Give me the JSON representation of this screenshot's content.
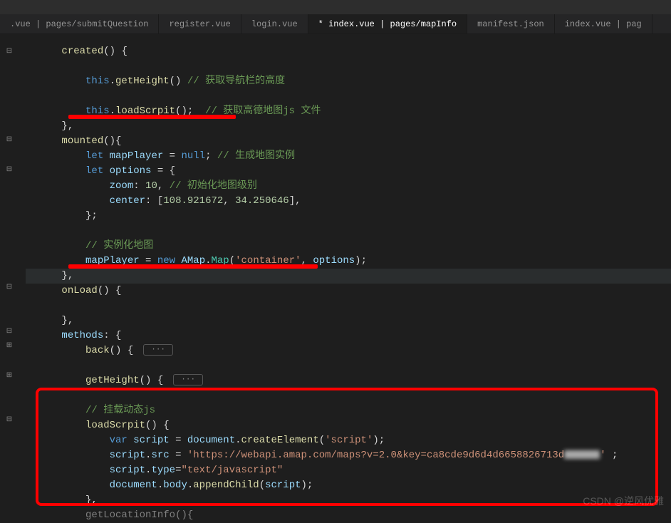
{
  "tabs": [
    {
      "label": ".vue | pages/submitQuestion",
      "active": false
    },
    {
      "label": "register.vue",
      "active": false
    },
    {
      "label": "login.vue",
      "active": false
    },
    {
      "label": "* index.vue | pages/mapInfo",
      "active": true
    },
    {
      "label": "manifest.json",
      "active": false
    },
    {
      "label": "index.vue | pag",
      "active": false
    }
  ],
  "code": {
    "l1_created": "created",
    "l1_paren": "() {",
    "l3_this": "this",
    "l3_getHeight": "getHeight",
    "l3_cmt": "// 获取导航栏的高度",
    "l5_this": "this",
    "l5_loadScrpit": "loadScrpit",
    "l5_cmt": "// 获取高德地图js 文件",
    "l6_close": "},",
    "l7_mounted": "mounted",
    "l7_paren": "(){",
    "l8_let": "let",
    "l8_mapPlayer": "mapPlayer",
    "l8_eq": " = ",
    "l8_null": "null",
    "l8_cmt": "// 生成地图实例",
    "l9_let": "let",
    "l9_options": "options",
    "l9_eq": " = {",
    "l10_zoom": "zoom",
    "l10_col": ": ",
    "l10_10": "10",
    "l10_cmt": "// 初始化地图级别",
    "l11_center": "center",
    "l11_col": ": [",
    "l11_n1": "108.921672",
    "l11_c": ", ",
    "l11_n2": "34.250646",
    "l11_close": "],",
    "l12_close": "};",
    "l14_cmt": "// 实例化地图",
    "l15_mapPlayer": "mapPlayer",
    "l15_eq": " = ",
    "l15_new": "new",
    "l15_AMap": "AMap",
    "l15_Map": "Map",
    "l15_container": "'container'",
    "l15_options": "options",
    "l16_close": "},",
    "l17_onLoad": "onLoad",
    "l17_paren": "() {",
    "l19_close": "},",
    "l20_methods": "methods",
    "l20_col": ": {",
    "l21_back": "back",
    "l21_paren": "() {",
    "l23_getHeight": "getHeight",
    "l23_paren": "() {",
    "l25_cmt": "// 挂载动态js",
    "l26_loadScrpit": "loadScrpit",
    "l26_paren": "() {",
    "l27_var": "var",
    "l27_script": "script",
    "l27_eq": " = ",
    "l27_document": "document",
    "l27_createElement": "createElement",
    "l27_scriptStr": "'script'",
    "l28_script": "script",
    "l28_src": "src",
    "l28_eq": " = ",
    "l28_url": "'https://webapi.amap.com/maps?v=2.0&key=ca8cde9d6d4d6658826713d",
    "l29_script": "script",
    "l29_type": "type",
    "l29_eq": "=",
    "l29_val": "\"text/javascript\"",
    "l30_document": "document",
    "l30_body": "body",
    "l30_appendChild": "appendChild",
    "l30_script": "script",
    "l31_close": "},",
    "l32_getLocationInfo": "getLocationInfo",
    "l32_paren": "(){",
    "fold_dots": "···"
  },
  "watermark": "CSDN @逆风优雅"
}
